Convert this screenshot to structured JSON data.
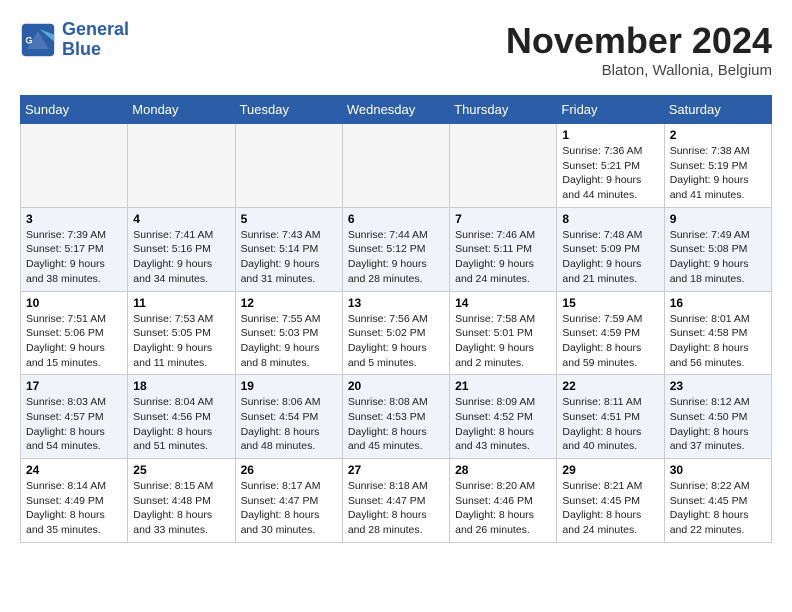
{
  "header": {
    "logo_line1": "General",
    "logo_line2": "Blue",
    "month_title": "November 2024",
    "location": "Blaton, Wallonia, Belgium"
  },
  "days_of_week": [
    "Sunday",
    "Monday",
    "Tuesday",
    "Wednesday",
    "Thursday",
    "Friday",
    "Saturday"
  ],
  "weeks": [
    [
      {
        "day": "",
        "info": ""
      },
      {
        "day": "",
        "info": ""
      },
      {
        "day": "",
        "info": ""
      },
      {
        "day": "",
        "info": ""
      },
      {
        "day": "",
        "info": ""
      },
      {
        "day": "1",
        "info": "Sunrise: 7:36 AM\nSunset: 5:21 PM\nDaylight: 9 hours and 44 minutes."
      },
      {
        "day": "2",
        "info": "Sunrise: 7:38 AM\nSunset: 5:19 PM\nDaylight: 9 hours and 41 minutes."
      }
    ],
    [
      {
        "day": "3",
        "info": "Sunrise: 7:39 AM\nSunset: 5:17 PM\nDaylight: 9 hours and 38 minutes."
      },
      {
        "day": "4",
        "info": "Sunrise: 7:41 AM\nSunset: 5:16 PM\nDaylight: 9 hours and 34 minutes."
      },
      {
        "day": "5",
        "info": "Sunrise: 7:43 AM\nSunset: 5:14 PM\nDaylight: 9 hours and 31 minutes."
      },
      {
        "day": "6",
        "info": "Sunrise: 7:44 AM\nSunset: 5:12 PM\nDaylight: 9 hours and 28 minutes."
      },
      {
        "day": "7",
        "info": "Sunrise: 7:46 AM\nSunset: 5:11 PM\nDaylight: 9 hours and 24 minutes."
      },
      {
        "day": "8",
        "info": "Sunrise: 7:48 AM\nSunset: 5:09 PM\nDaylight: 9 hours and 21 minutes."
      },
      {
        "day": "9",
        "info": "Sunrise: 7:49 AM\nSunset: 5:08 PM\nDaylight: 9 hours and 18 minutes."
      }
    ],
    [
      {
        "day": "10",
        "info": "Sunrise: 7:51 AM\nSunset: 5:06 PM\nDaylight: 9 hours and 15 minutes."
      },
      {
        "day": "11",
        "info": "Sunrise: 7:53 AM\nSunset: 5:05 PM\nDaylight: 9 hours and 11 minutes."
      },
      {
        "day": "12",
        "info": "Sunrise: 7:55 AM\nSunset: 5:03 PM\nDaylight: 9 hours and 8 minutes."
      },
      {
        "day": "13",
        "info": "Sunrise: 7:56 AM\nSunset: 5:02 PM\nDaylight: 9 hours and 5 minutes."
      },
      {
        "day": "14",
        "info": "Sunrise: 7:58 AM\nSunset: 5:01 PM\nDaylight: 9 hours and 2 minutes."
      },
      {
        "day": "15",
        "info": "Sunrise: 7:59 AM\nSunset: 4:59 PM\nDaylight: 8 hours and 59 minutes."
      },
      {
        "day": "16",
        "info": "Sunrise: 8:01 AM\nSunset: 4:58 PM\nDaylight: 8 hours and 56 minutes."
      }
    ],
    [
      {
        "day": "17",
        "info": "Sunrise: 8:03 AM\nSunset: 4:57 PM\nDaylight: 8 hours and 54 minutes."
      },
      {
        "day": "18",
        "info": "Sunrise: 8:04 AM\nSunset: 4:56 PM\nDaylight: 8 hours and 51 minutes."
      },
      {
        "day": "19",
        "info": "Sunrise: 8:06 AM\nSunset: 4:54 PM\nDaylight: 8 hours and 48 minutes."
      },
      {
        "day": "20",
        "info": "Sunrise: 8:08 AM\nSunset: 4:53 PM\nDaylight: 8 hours and 45 minutes."
      },
      {
        "day": "21",
        "info": "Sunrise: 8:09 AM\nSunset: 4:52 PM\nDaylight: 8 hours and 43 minutes."
      },
      {
        "day": "22",
        "info": "Sunrise: 8:11 AM\nSunset: 4:51 PM\nDaylight: 8 hours and 40 minutes."
      },
      {
        "day": "23",
        "info": "Sunrise: 8:12 AM\nSunset: 4:50 PM\nDaylight: 8 hours and 37 minutes."
      }
    ],
    [
      {
        "day": "24",
        "info": "Sunrise: 8:14 AM\nSunset: 4:49 PM\nDaylight: 8 hours and 35 minutes."
      },
      {
        "day": "25",
        "info": "Sunrise: 8:15 AM\nSunset: 4:48 PM\nDaylight: 8 hours and 33 minutes."
      },
      {
        "day": "26",
        "info": "Sunrise: 8:17 AM\nSunset: 4:47 PM\nDaylight: 8 hours and 30 minutes."
      },
      {
        "day": "27",
        "info": "Sunrise: 8:18 AM\nSunset: 4:47 PM\nDaylight: 8 hours and 28 minutes."
      },
      {
        "day": "28",
        "info": "Sunrise: 8:20 AM\nSunset: 4:46 PM\nDaylight: 8 hours and 26 minutes."
      },
      {
        "day": "29",
        "info": "Sunrise: 8:21 AM\nSunset: 4:45 PM\nDaylight: 8 hours and 24 minutes."
      },
      {
        "day": "30",
        "info": "Sunrise: 8:22 AM\nSunset: 4:45 PM\nDaylight: 8 hours and 22 minutes."
      }
    ]
  ]
}
